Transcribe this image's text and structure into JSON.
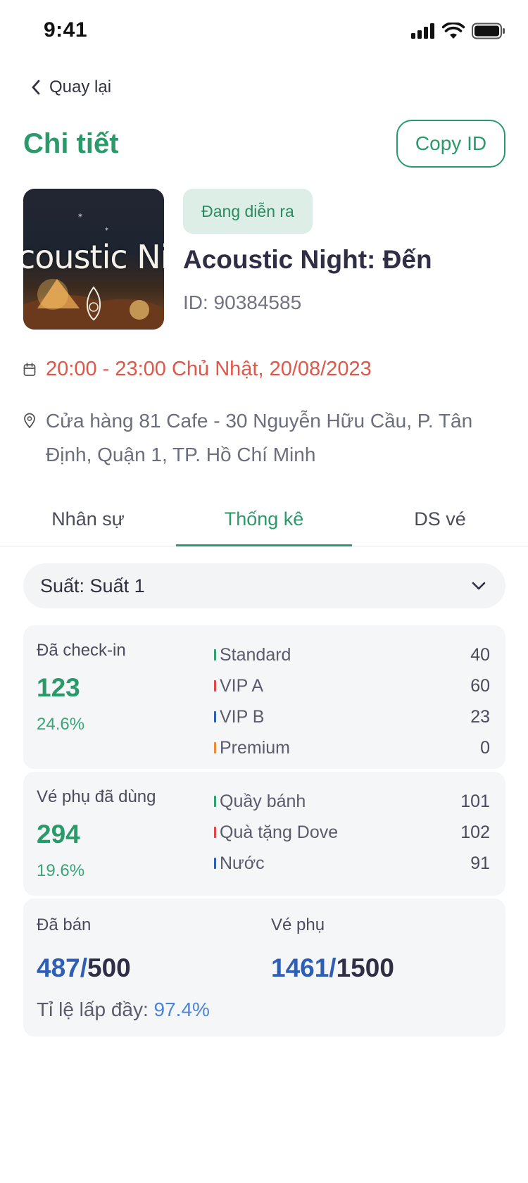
{
  "status_bar": {
    "time": "9:41"
  },
  "nav": {
    "back_label": "Quay lại"
  },
  "header": {
    "title": "Chi tiết",
    "copy_button": "Copy ID"
  },
  "event": {
    "thumbnail_text": "coustic Night",
    "status_badge": "Đang diễn ra",
    "name": "Acoustic Night: Đến",
    "id": "ID: 90384585",
    "datetime": "20:00 - 23:00 Chủ Nhật, 20/08/2023",
    "address": "Cửa hàng 81 Cafe - 30 Nguyễn Hữu Cầu, P. Tân Định, Quận 1, TP. Hồ Chí Minh"
  },
  "tabs": [
    {
      "label": "Nhân sự",
      "active": false
    },
    {
      "label": "Thống kê",
      "active": true
    },
    {
      "label": "DS vé",
      "active": false
    }
  ],
  "session_select": {
    "value": "Suất: Suất 1"
  },
  "checkin": {
    "title": "Đã check-in",
    "value": "123",
    "percent": "24.6%",
    "items": [
      {
        "name": "Standard",
        "value": "40",
        "color": "#2ea36f"
      },
      {
        "name": "VIP A",
        "value": "60",
        "color": "#e04848"
      },
      {
        "name": "VIP B",
        "value": "23",
        "color": "#2f5fb4"
      },
      {
        "name": "Premium",
        "value": "0",
        "color": "#ef8a33"
      }
    ]
  },
  "addons": {
    "title": "Vé phụ đã dùng",
    "value": "294",
    "percent": "19.6%",
    "items": [
      {
        "name": "Quầy bánh",
        "value": "101",
        "color": "#2ea36f"
      },
      {
        "name": "Quà tặng Dove",
        "value": "102",
        "color": "#e04848"
      },
      {
        "name": "Nước",
        "value": "91",
        "color": "#2f5fb4"
      }
    ]
  },
  "sales": {
    "sold_label": "Đã bán",
    "sold_value": "487/",
    "sold_total": "500",
    "addon_label": "Vé phụ",
    "addon_value": "1461/",
    "addon_total": "1500",
    "fill_label": "Tỉ lệ lấp đầy: ",
    "fill_value": "97.4%"
  }
}
